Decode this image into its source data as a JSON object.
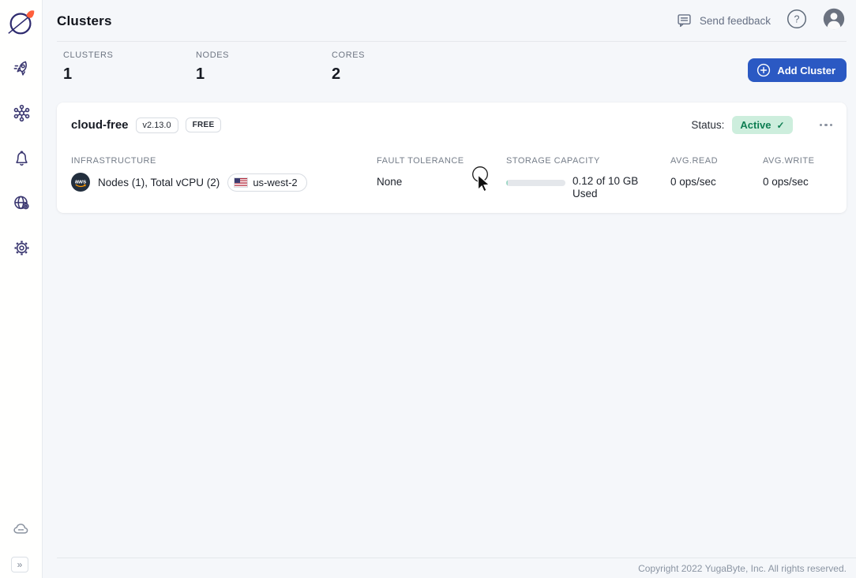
{
  "header": {
    "title": "Clusters",
    "send_feedback": "Send feedback"
  },
  "sidebar": {
    "icons": [
      "yugabyte-logo",
      "rocket-icon",
      "cluster-network-icon",
      "bell-icon",
      "globe-settings-icon",
      "gear-icon",
      "cloud-status-icon",
      "expand-sidebar-icon"
    ],
    "expand_glyph": "»"
  },
  "stats": [
    {
      "label": "CLUSTERS",
      "value": "1"
    },
    {
      "label": "NODES",
      "value": "1"
    },
    {
      "label": "CORES",
      "value": "2"
    }
  ],
  "actions": {
    "add_cluster": "Add Cluster"
  },
  "cluster_card": {
    "name": "cloud-free",
    "version_badge": "v2.13.0",
    "tier_badge": "FREE",
    "status_label": "Status:",
    "status_value": "Active",
    "infrastructure": {
      "label": "INFRASTRUCTURE",
      "provider_icon": "aws-icon",
      "summary": "Nodes (1), Total vCPU (2)",
      "region": "us-west-2"
    },
    "fault_tolerance": {
      "label": "FAULT TOLERANCE",
      "value": "None"
    },
    "storage": {
      "label": "STORAGE CAPACITY",
      "value": "0.12 of 10 GB Used",
      "fill_percent": 3
    },
    "avg_read": {
      "label": "AVG.READ",
      "value": "0 ops/sec"
    },
    "avg_write": {
      "label": "AVG.WRITE",
      "value": "0 ops/sec"
    }
  },
  "footer": {
    "copyright": "Copyright 2022 YugaByte, Inc. All rights reserved."
  },
  "colors": {
    "accent_blue": "#2b59c3",
    "brand_navy": "#2d2a6e",
    "brand_orange": "#ff5f3b",
    "status_badge_bg": "#cdeedd",
    "status_badge_text": "#0e7e52",
    "progress_fill": "#9ed8c6",
    "aws_smile_orange": "#ff9900"
  }
}
